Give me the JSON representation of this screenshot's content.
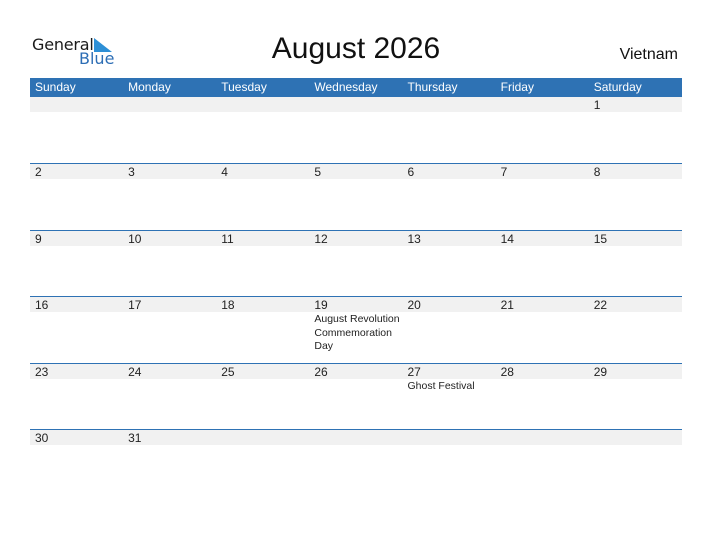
{
  "logo": {
    "word1": "General",
    "word2": "Blue",
    "icon": "triangle-flag-icon"
  },
  "title": "August 2026",
  "country": "Vietnam",
  "colors": {
    "header_bg": "#2e72b4",
    "band_bg": "#f1f1f1",
    "logo_blue": "#2d6eb5"
  },
  "weekdays": [
    "Sunday",
    "Monday",
    "Tuesday",
    "Wednesday",
    "Thursday",
    "Friday",
    "Saturday"
  ],
  "weeks": [
    [
      {
        "d": ""
      },
      {
        "d": ""
      },
      {
        "d": ""
      },
      {
        "d": ""
      },
      {
        "d": ""
      },
      {
        "d": ""
      },
      {
        "d": "1"
      }
    ],
    [
      {
        "d": "2"
      },
      {
        "d": "3"
      },
      {
        "d": "4"
      },
      {
        "d": "5"
      },
      {
        "d": "6"
      },
      {
        "d": "7"
      },
      {
        "d": "8"
      }
    ],
    [
      {
        "d": "9"
      },
      {
        "d": "10"
      },
      {
        "d": "11"
      },
      {
        "d": "12"
      },
      {
        "d": "13"
      },
      {
        "d": "14"
      },
      {
        "d": "15"
      }
    ],
    [
      {
        "d": "16"
      },
      {
        "d": "17"
      },
      {
        "d": "18"
      },
      {
        "d": "19",
        "event": "August Revolution Commemoration Day"
      },
      {
        "d": "20"
      },
      {
        "d": "21"
      },
      {
        "d": "22"
      }
    ],
    [
      {
        "d": "23"
      },
      {
        "d": "24"
      },
      {
        "d": "25"
      },
      {
        "d": "26"
      },
      {
        "d": "27",
        "event": "Ghost Festival"
      },
      {
        "d": "28"
      },
      {
        "d": "29"
      }
    ],
    [
      {
        "d": "30"
      },
      {
        "d": "31"
      },
      {
        "d": ""
      },
      {
        "d": ""
      },
      {
        "d": ""
      },
      {
        "d": ""
      },
      {
        "d": ""
      }
    ]
  ]
}
